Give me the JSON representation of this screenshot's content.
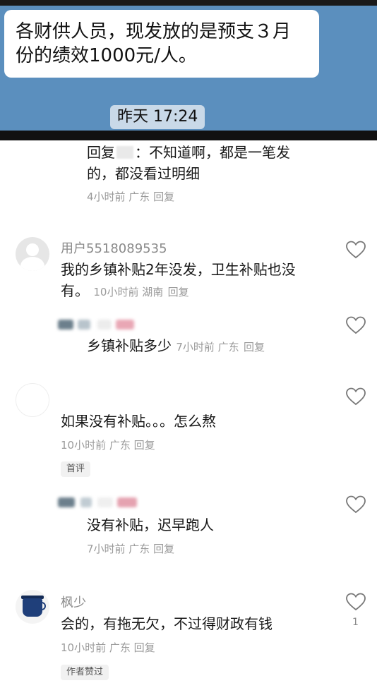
{
  "chat": {
    "message_line1": "各财供人员，现发放的是预支３月",
    "message_line2": "份的绩效1000元/人。",
    "timestamp": "昨天 17:24"
  },
  "comments": [
    {
      "reply_text_line1": "回复",
      "reply_text_line1b": "：不知道啊，都是一笔发",
      "reply_text_line2": "的，都没看过明细",
      "meta": "4小时前 广东",
      "reply_label": "回复"
    },
    {
      "username": "用户5518089535",
      "text_line1": "我的乡镇补贴2年没发，卫生补贴也没",
      "text_line2": "有。",
      "meta": "10小时前 湖南",
      "reply_label": "回复"
    },
    {
      "text": "乡镇补贴多少",
      "meta": "7小时前 广东",
      "reply_label": "回复"
    },
    {
      "text": "如果没有补贴。。。怎么熬",
      "meta": "10小时前 广东",
      "reply_label": "回复",
      "badge": "首评"
    },
    {
      "text": "没有补贴，迟早跑人",
      "meta": "7小时前 广东",
      "reply_label": "回复"
    },
    {
      "username": "枫少",
      "text": "会的，有拖无欠，不过得财政有钱",
      "meta": "10小时前 广东",
      "reply_label": "回复",
      "badge": "作者赞过",
      "like_count": "1"
    }
  ],
  "icons": {
    "like": "heart-outline-icon",
    "default_avatar": "default-user-avatar-icon"
  },
  "colors": {
    "chat_background": "#5b8fbe",
    "meta_text": "#9a9a9a"
  }
}
